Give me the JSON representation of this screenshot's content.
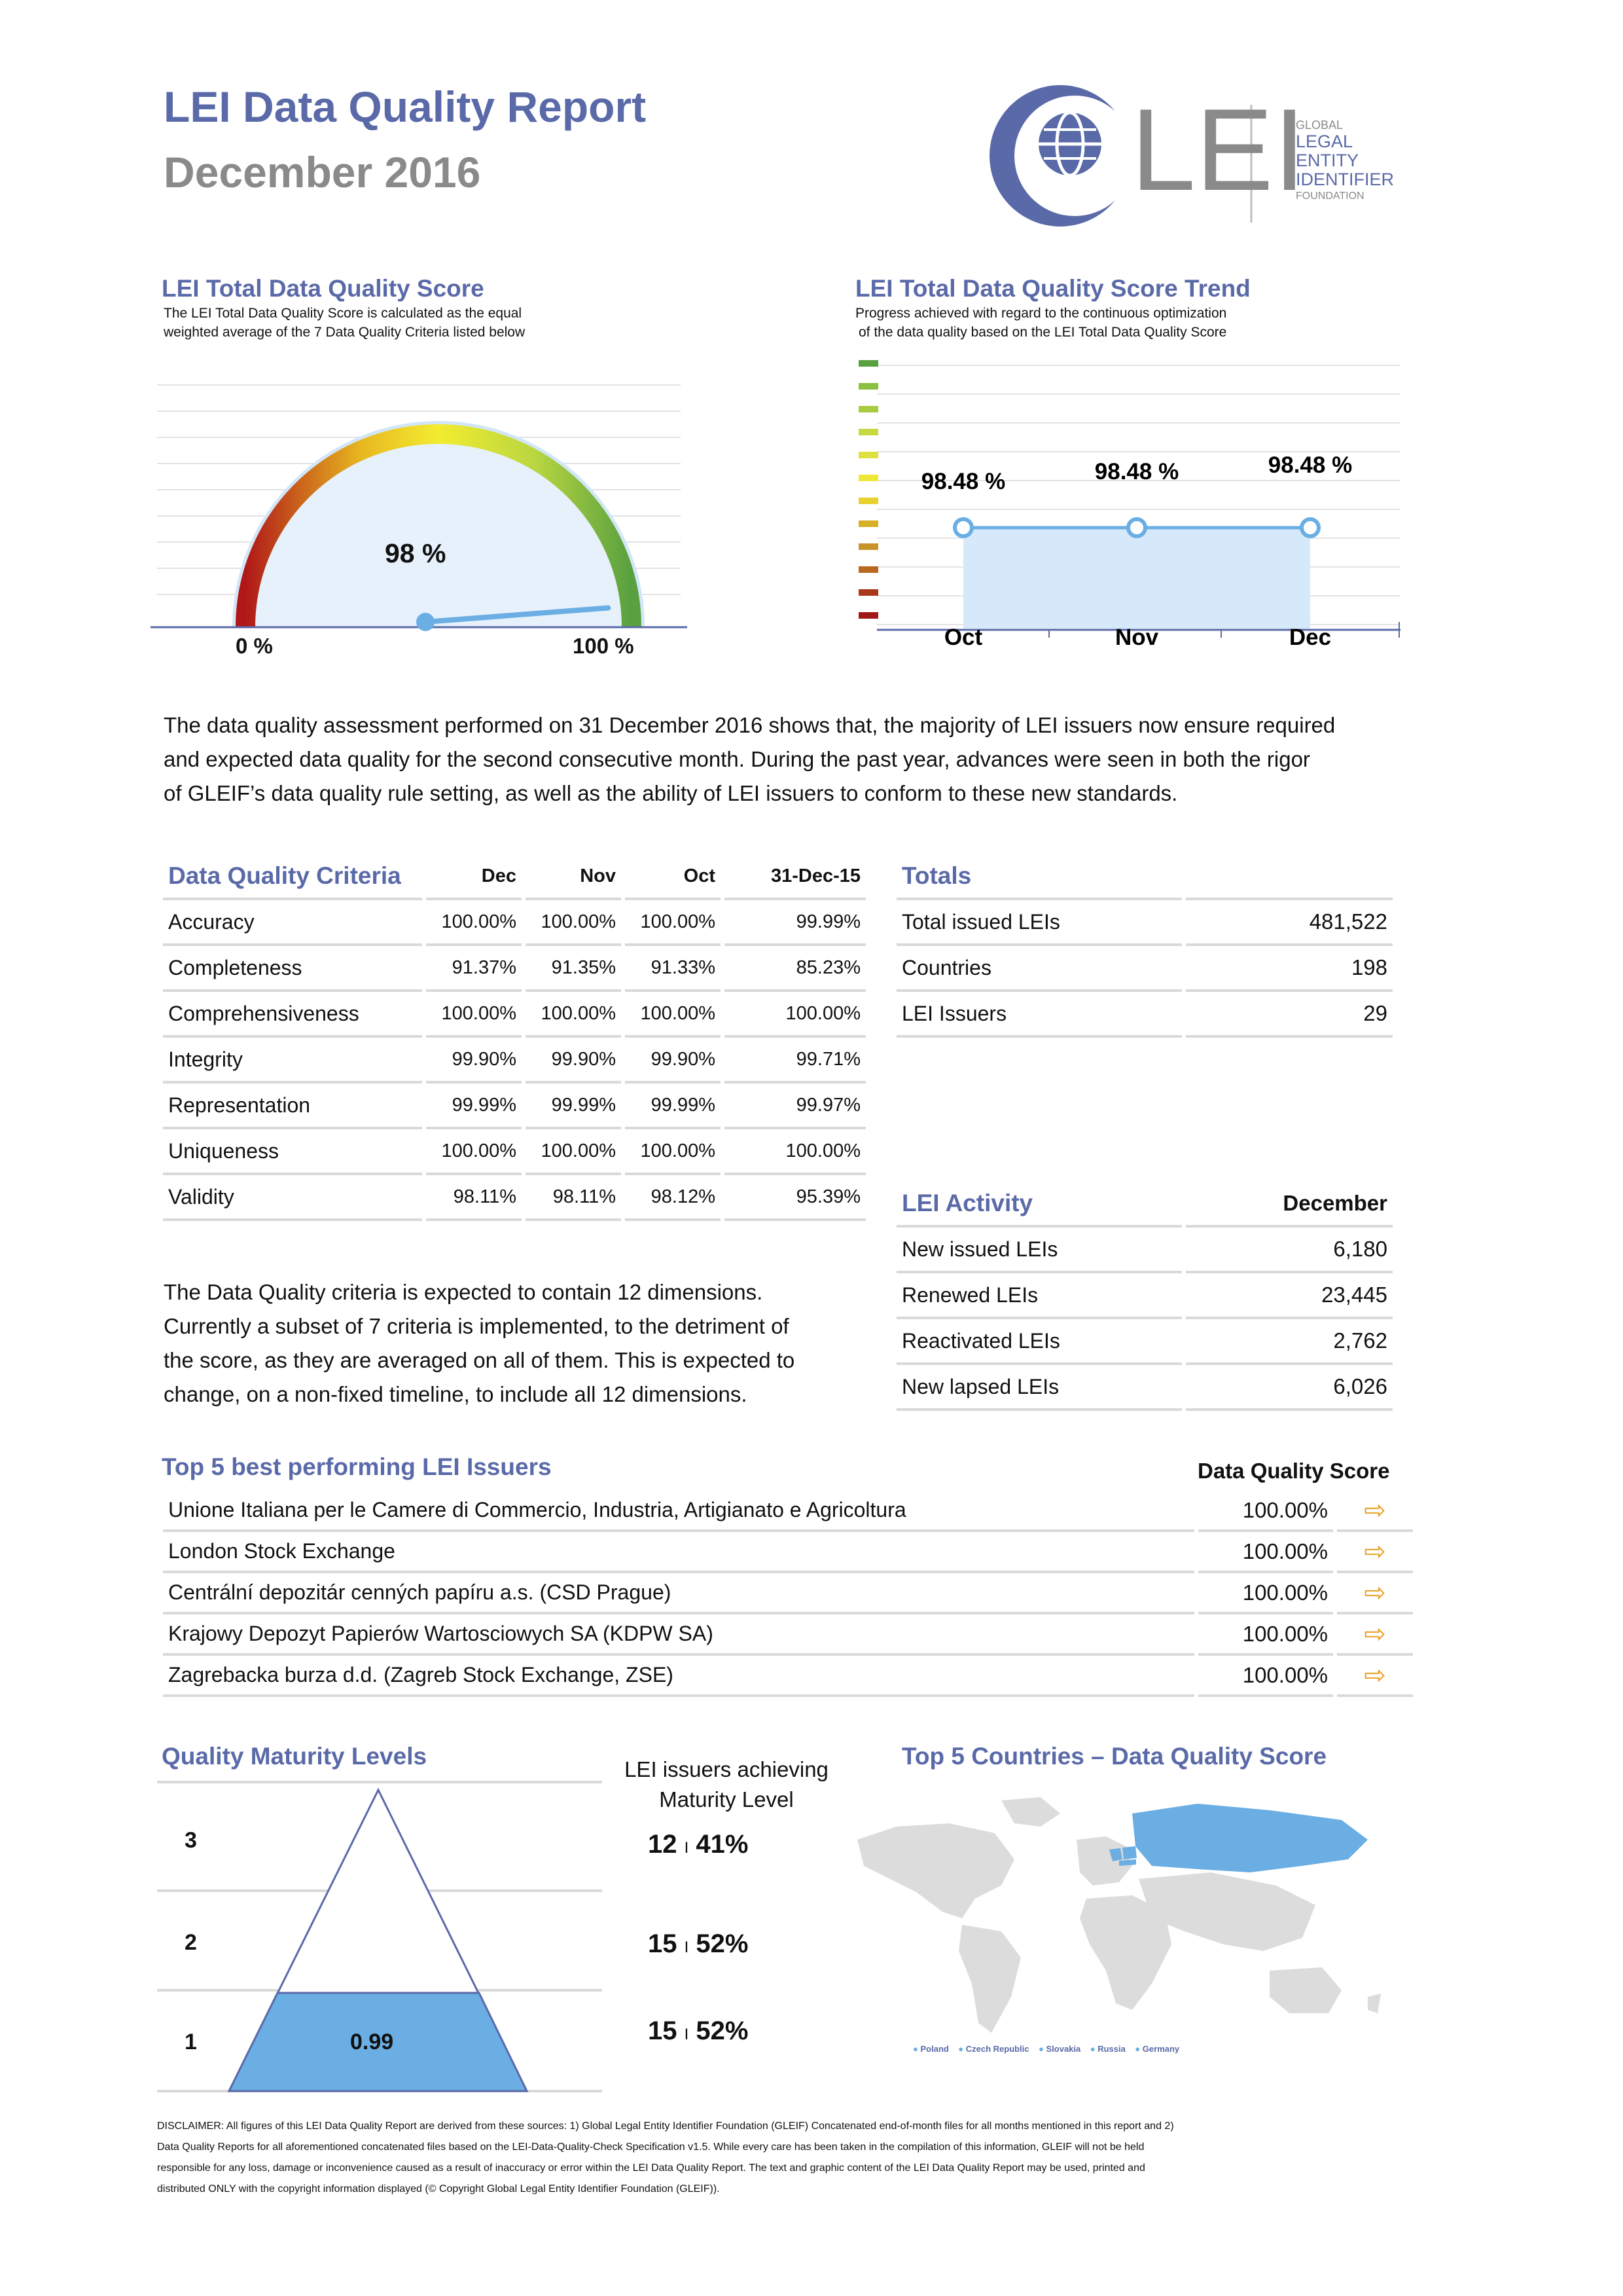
{
  "header": {
    "title": "LEI Data Quality Report",
    "subtitle": "December 2016",
    "logo_text": "LEI",
    "logo_lines": [
      "GLOBAL",
      "LEGAL",
      "ENTITY",
      "IDENTIFIER",
      "FOUNDATION"
    ],
    "logo_colors": {
      "ring": "#5a6aa8",
      "text": "#8a8a8a"
    }
  },
  "score_gauge": {
    "title": "LEI Total Data Quality Score",
    "note_line1": "The LEI Total Data Quality Score is calculated as the equal",
    "note_line2": "weighted average of the 7 Data Quality Criteria listed below",
    "value_label": "98 %",
    "min_label": "0 %",
    "max_label": "100 %",
    "value": 98
  },
  "trend": {
    "title": "LEI Total Data Quality Score Trend",
    "note_line1": "Progress achieved with regard to the continuous optimization",
    "note_line2": "of the data quality based on the LEI Total Data Quality Score",
    "chart_data": {
      "type": "line",
      "categories": [
        "Oct",
        "Nov",
        "Dec"
      ],
      "values": [
        98.48,
        98.48,
        98.48
      ],
      "labels": [
        "98.48 %",
        "98.48 %",
        "98.48 %"
      ]
    }
  },
  "intro": {
    "line1": "The data quality assessment performed on 31 December 2016 shows that, the majority of LEI issuers now ensure required",
    "line2": "and expected data quality for the second consecutive month. During the past year, advances were seen in both the rigor",
    "line3": "of GLEIF’s data quality rule setting, as well as the ability of LEI issuers to conform to these new standards."
  },
  "criteria": {
    "title": "Data Quality Criteria",
    "columns": [
      "Dec",
      "Nov",
      "Oct",
      "31-Dec-15"
    ],
    "rows": [
      {
        "name": "Accuracy",
        "dec": "100.00%",
        "nov": "100.00%",
        "oct": "100.00%",
        "prev": "99.99%"
      },
      {
        "name": "Completeness",
        "dec": "91.37%",
        "nov": "91.35%",
        "oct": "91.33%",
        "prev": "85.23%"
      },
      {
        "name": "Comprehensiveness",
        "dec": "100.00%",
        "nov": "100.00%",
        "oct": "100.00%",
        "prev": "100.00%"
      },
      {
        "name": "Integrity",
        "dec": "99.90%",
        "nov": "99.90%",
        "oct": "99.90%",
        "prev": "99.71%"
      },
      {
        "name": "Representation",
        "dec": "99.99%",
        "nov": "99.99%",
        "oct": "99.99%",
        "prev": "99.97%"
      },
      {
        "name": "Uniqueness",
        "dec": "100.00%",
        "nov": "100.00%",
        "oct": "100.00%",
        "prev": "100.00%"
      },
      {
        "name": "Validity",
        "dec": "98.11%",
        "nov": "98.11%",
        "oct": "98.12%",
        "prev": "95.39%"
      }
    ],
    "note_line1": "The Data Quality criteria is expected to contain 12 dimensions.",
    "note_line2": "Currently a subset of 7 criteria is implemented, to the detriment of",
    "note_line3": "the score, as they are averaged on all of them. This is expected to",
    "note_line4": "change, on a non-fixed timeline, to include all 12 dimensions."
  },
  "totals": {
    "title": "Totals",
    "rows": [
      {
        "label": "Total issued LEIs",
        "value": "481,522"
      },
      {
        "label": "Countries",
        "value": "198"
      },
      {
        "label": "LEI Issuers",
        "value": "29"
      }
    ]
  },
  "activity": {
    "title": "LEI Activity",
    "column": "December",
    "rows": [
      {
        "label": "New issued LEIs",
        "value": "6,180"
      },
      {
        "label": "Renewed LEIs",
        "value": "23,445"
      },
      {
        "label": "Reactivated LEIs",
        "value": "2,762"
      },
      {
        "label": "New lapsed LEIs",
        "value": "6,026"
      }
    ]
  },
  "top_issuers": {
    "title": "Top 5 best performing LEI Issuers",
    "column": "Data Quality Score",
    "rows": [
      {
        "name": "Unione Italiana per le Camere di Commercio, Industria, Artigianato e Agricoltura",
        "score": "100.00%"
      },
      {
        "name": "London Stock Exchange",
        "score": "100.00%"
      },
      {
        "name": "Centrální depozitár cenných papíru a.s. (CSD Prague)",
        "score": "100.00%"
      },
      {
        "name": "Krajowy Depozyt Papierów Wartosciowych SA (KDPW SA)",
        "score": "100.00%"
      },
      {
        "name": "Zagrebacka burza d.d. (Zagreb Stock Exchange, ZSE)",
        "score": "100.00%"
      }
    ]
  },
  "maturity": {
    "title": "Quality Maturity Levels",
    "col_line1": "LEI issuers achieving",
    "col_line2": "Maturity Level",
    "levels": [
      "3",
      "2",
      "1"
    ],
    "fill_label": "0.99",
    "values": [
      {
        "count": "12",
        "sep": "I",
        "pct": "41%"
      },
      {
        "count": "15",
        "sep": "I",
        "pct": "52%"
      },
      {
        "count": "15",
        "sep": "I",
        "pct": "52%"
      }
    ]
  },
  "countries": {
    "title": "Top 5 Countries – Data Quality Score",
    "legend": [
      "Poland",
      "Czech Republic",
      "Slovakia",
      "Russia",
      "Germany"
    ],
    "highlight_color": "#6aaee3"
  },
  "disclaimer": {
    "line1": "DISCLAIMER: All figures of this LEI Data Quality Report are derived from these sources: 1) Global Legal Entity Identifier Foundation (GLEIF) Concatenated end-of-month files for all months mentioned in this report and 2)",
    "line2": "Data Quality Reports for all aforementioned concatenated files based on the LEI-Data-Quality-Check Specification v1.5. While every care has been taken in the compilation of this information, GLEIF will not be held",
    "line3": "responsible for any loss, damage or inconvenience caused as a result of inaccuracy or error within the LEI Data Quality Report. The text and graphic content of the LEI Data Quality Report may be used, printed and",
    "line4": "distributed ONLY with the copyright information displayed (© Copyright Global Legal Entity Identifier Foundation (GLEIF))."
  }
}
